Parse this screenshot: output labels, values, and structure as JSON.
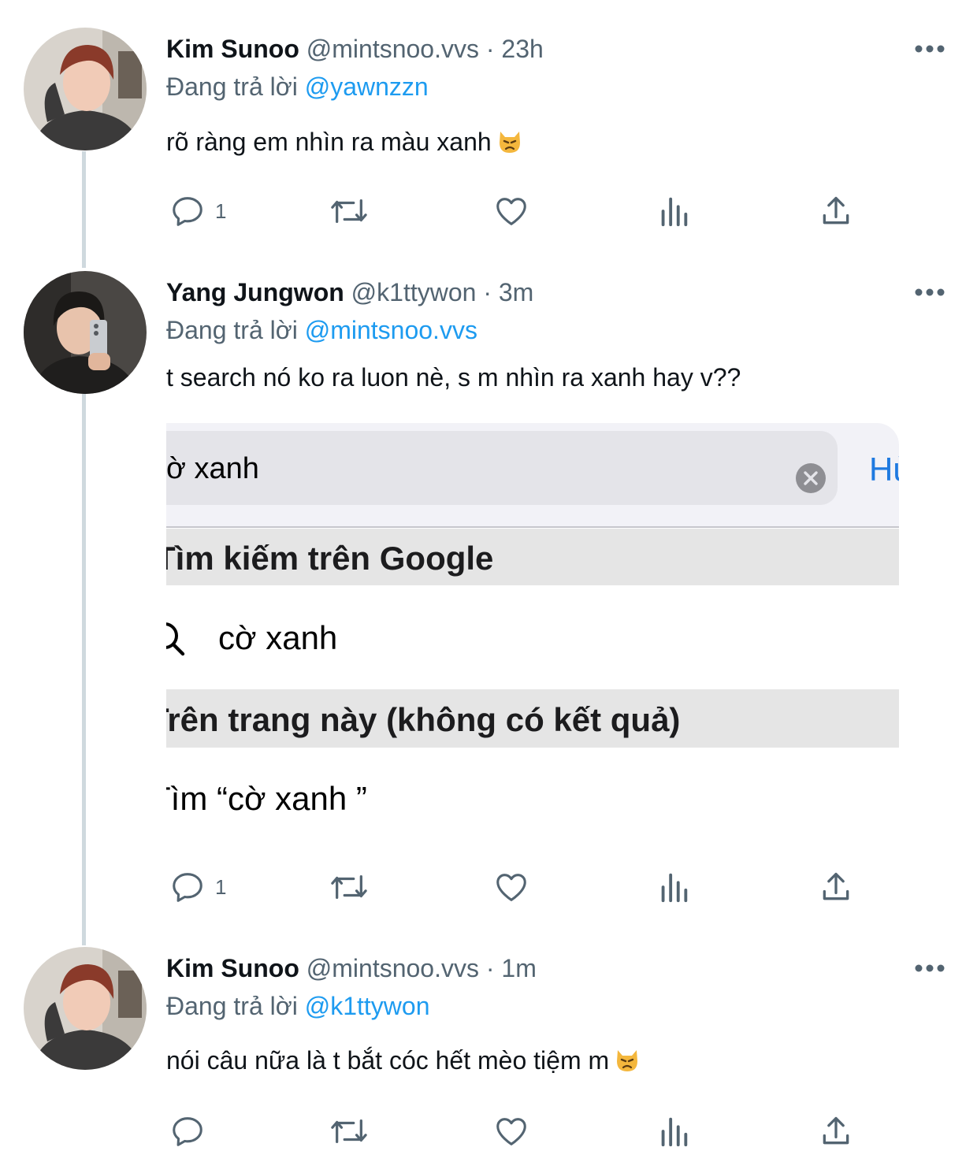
{
  "colors": {
    "link": "#1d9bf0",
    "muted": "#536471",
    "text": "#0f1419",
    "ios_blue": "#1f7ae0"
  },
  "tweets": [
    {
      "name": "Kim Sunoo",
      "meta": "@mintsnoo.vvs · 23h",
      "reply_prefix": "Đang trả lời",
      "reply_to": "@yawnzzn",
      "text": "rõ ràng em nhìn ra màu xanh",
      "emoji": "pouting-cat-emoji",
      "counts": {
        "replies": "1"
      }
    },
    {
      "name": "Yang Jungwon",
      "meta": "@k1ttywon · 3m",
      "reply_prefix": "Đang trả lời",
      "reply_to": "@mintsnoo.vvs",
      "text": "t search nó ko ra luon nè, s m nhìn ra xanh hay v??",
      "counts": {
        "replies": "1"
      }
    },
    {
      "name": "Kim Sunoo",
      "meta": "@mintsnoo.vvs · 1m",
      "reply_prefix": "Đang trả lời",
      "reply_to": "@k1ttywon",
      "text": "nói câu nữa là t bắt cóc hết mèo tiệm m",
      "emoji": "pouting-cat-emoji",
      "counts": {
        "replies": ""
      }
    }
  ],
  "media": {
    "search_text": "ờ xanh",
    "cancel": "Hủ",
    "section_google": "Tìm kiếm trên Google",
    "suggestion": "cờ xanh",
    "section_page": "Trên trang này (không có kết quả)",
    "find_text": "Tìm “cờ xanh ”"
  },
  "icons": [
    "reply-icon",
    "retweet-icon",
    "like-icon",
    "views-icon",
    "share-icon",
    "more-icon"
  ]
}
